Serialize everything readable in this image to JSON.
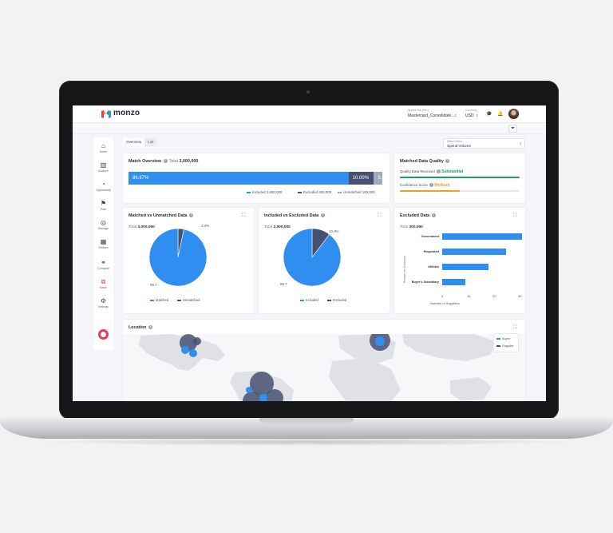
{
  "app": {
    "brand": "monzo",
    "spend_file_label": "Spend File (Yer.)",
    "spend_file_value": "Mastercard_Consolidate...",
    "currency_label": "Currency",
    "currency_value": "USD"
  },
  "sidebar": {
    "items": [
      {
        "label": "Home",
        "icon": "⌂"
      },
      {
        "label": "Analyze",
        "icon": "▥"
      },
      {
        "label": "Opportunity",
        "icon": "◔"
      },
      {
        "label": "Plan",
        "icon": "⚑"
      },
      {
        "label": "Manage",
        "icon": "◎"
      },
      {
        "label": "Entities",
        "icon": "▦"
      },
      {
        "label": "Compare",
        "icon": "⚭"
      },
      {
        "label": "Match",
        "icon": "⧉"
      },
      {
        "label": "Settings",
        "icon": "⚙"
      }
    ]
  },
  "tabs": [
    "Overview",
    "List"
  ],
  "metric": {
    "label": "Select Metric",
    "value": "Spend Volume"
  },
  "match_overview": {
    "title": "Match Overview",
    "total_label": "Total",
    "total_value": "3,000,000",
    "segments": [
      {
        "label": "86.67%",
        "pct": 86.67,
        "color": "#2f8ef0"
      },
      {
        "label": "10.00%",
        "pct": 10.0,
        "color": "#465070"
      },
      {
        "label": "3.33%",
        "pct": 3.33,
        "color": "#a3a9b8"
      }
    ],
    "legend": [
      {
        "text": "Included",
        "value": "2,600,000",
        "color": "#2f8ef0"
      },
      {
        "text": "Excluded",
        "value": "300,000",
        "color": "#465070"
      },
      {
        "text": "Unmatched",
        "value": "100,000",
        "color": "#a3a9b8"
      }
    ]
  },
  "matched_data_quality": {
    "title": "Matched Data Quality",
    "received_label": "Quality Data Received",
    "received_value": "Substantial",
    "received_color": "#17a06a",
    "received_level": 1.0,
    "confidence_label": "Confidence Score",
    "confidence_value": "Medium",
    "confidence_color": "#f0a020",
    "confidence_level": 0.5
  },
  "matched_vs_unmatched": {
    "title": "Matched vs Unmatched Data",
    "total_label": "Total",
    "total_value": "3,000,000",
    "slices": [
      {
        "name": "Matched",
        "pct": 96.7,
        "label": "96.7",
        "color": "#2f8ef0"
      },
      {
        "name": "Unmatched",
        "pct": 3.3,
        "label": "3.3%",
        "color": "#465070"
      }
    ]
  },
  "included_vs_excluded": {
    "title": "Included vs Excluded Data",
    "total_label": "Total",
    "total_value": "2,900,000",
    "slices": [
      {
        "name": "Included",
        "pct": 89.7,
        "label": "89.7",
        "color": "#2f8ef0"
      },
      {
        "name": "Excluded",
        "pct": 10.3,
        "label": "10.3%",
        "color": "#465070"
      }
    ]
  },
  "excluded_data": {
    "title": "Excluded Data",
    "total_label": "Total",
    "total_value": "300,000",
    "ylabel": "Reason for Exclusion",
    "xlabel": "Number of Suppliers"
  },
  "chart_data": [
    {
      "type": "bar",
      "orientation": "horizontal",
      "title": "Excluded Data",
      "categories": [
        "Government",
        "Requested",
        "Utilities",
        "Buyer's Subsidiary"
      ],
      "values": [
        33,
        25,
        18,
        9
      ],
      "xlabel": "Number of Suppliers",
      "ylabel": "Reason for Exclusion",
      "xlim": [
        0,
        30
      ],
      "xticks": [
        "0",
        "10",
        "20",
        "30"
      ]
    },
    {
      "type": "pie",
      "title": "Matched vs Unmatched Data",
      "categories": [
        "Matched",
        "Unmatched"
      ],
      "values": [
        96.7,
        3.3
      ]
    },
    {
      "type": "pie",
      "title": "Included vs Excluded Data",
      "categories": [
        "Included",
        "Excluded"
      ],
      "values": [
        89.7,
        10.3
      ]
    }
  ],
  "location": {
    "title": "Location",
    "legend": [
      {
        "text": "Buyer",
        "color": "#2f8ef0"
      },
      {
        "text": "Supplier",
        "color": "#465070"
      }
    ]
  }
}
